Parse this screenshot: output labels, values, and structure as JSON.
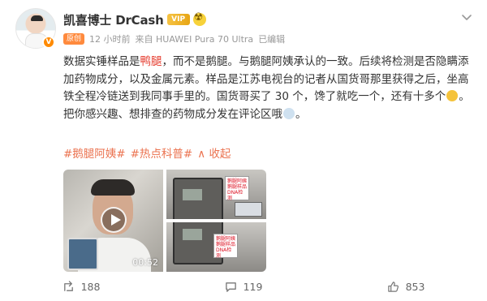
{
  "post": {
    "username": "凯喜博士 DrCash",
    "vip_badge": "VIP",
    "fan_badge": "原创",
    "time": "12 小时前",
    "source": "来自 HUAWEI Pura 70 Ultra",
    "edited": "已编辑",
    "content": {
      "part1": "数据实锤样品是",
      "highlight": "鸭腿",
      "part2": "，而不是鹅腿。与鹅腿阿姨承认的一致。后续将检测是否隐瞒添加药物成分，以及金属元素。样品是江苏电视台的记者从国货哥那里获得之后，坐高铁全程冷链送到我同事手里的。国货哥买了 30 个，馋了就吃一个，还有十多个",
      "part3": "。把你感兴趣、想排查的药物成分发在评论区哦",
      "part4": "。"
    },
    "tags": [
      "#鹅腿阿姨#",
      "#热点科普#"
    ],
    "collapse_label": "收起",
    "video_duration": "00:52",
    "photo_note_top": "鹅腿阿姨鹅腿样品 DNA检测",
    "photo_note_bottom": "鹅腿阿姨鹅腿样品 DNA检测"
  },
  "actions": {
    "repost_count": "188",
    "comment_count": "119",
    "like_count": "853"
  },
  "icons": {
    "verify": "verified-icon",
    "fan": "fan-club-icon",
    "more": "chevron-down-icon",
    "play": "play-icon",
    "repost": "repost-icon",
    "comment": "comment-icon",
    "like": "like-icon"
  },
  "colors": {
    "accent": "#eb7350",
    "highlight": "#e5392b",
    "verify": "#ff8a00"
  }
}
